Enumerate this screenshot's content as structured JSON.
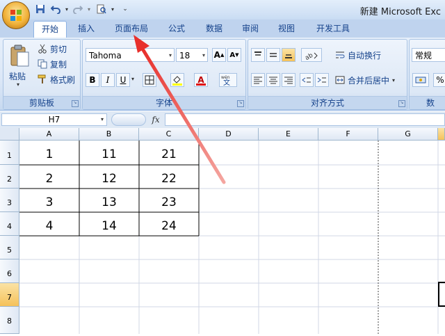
{
  "window": {
    "title": "新建 Microsoft Exc"
  },
  "quick_access": [
    "save-icon",
    "undo-icon",
    "redo-icon",
    "print-preview-icon"
  ],
  "tabs": [
    {
      "label": "开始",
      "active": true
    },
    {
      "label": "插入"
    },
    {
      "label": "页面布局"
    },
    {
      "label": "公式"
    },
    {
      "label": "数据"
    },
    {
      "label": "审阅"
    },
    {
      "label": "视图"
    },
    {
      "label": "开发工具"
    }
  ],
  "ribbon": {
    "clipboard": {
      "paste": "粘贴",
      "cut": "剪切",
      "copy": "复制",
      "format_painter": "格式刷",
      "label": "剪贴板"
    },
    "font": {
      "name": "Tahoma",
      "size": "18",
      "bold": "B",
      "italic": "I",
      "underline": "U",
      "label": "字体"
    },
    "alignment": {
      "wrap": "自动换行",
      "merge": "合并后居中",
      "label": "对齐方式"
    },
    "number": {
      "format": "常规",
      "percent": "%",
      "label": "数"
    }
  },
  "formula_bar": {
    "name_box": "H7",
    "fx": "fx",
    "value": ""
  },
  "columns": [
    "A",
    "B",
    "C",
    "D",
    "E",
    "F",
    "G"
  ],
  "rows": [
    "1",
    "2",
    "3",
    "4",
    "5",
    "6",
    "7",
    "8"
  ],
  "cells": [
    [
      "1",
      "11",
      "21"
    ],
    [
      "2",
      "12",
      "22"
    ],
    [
      "3",
      "13",
      "23"
    ],
    [
      "4",
      "14",
      "24"
    ]
  ],
  "annotation_color": "#e8302c",
  "accent": "#f5c25a"
}
